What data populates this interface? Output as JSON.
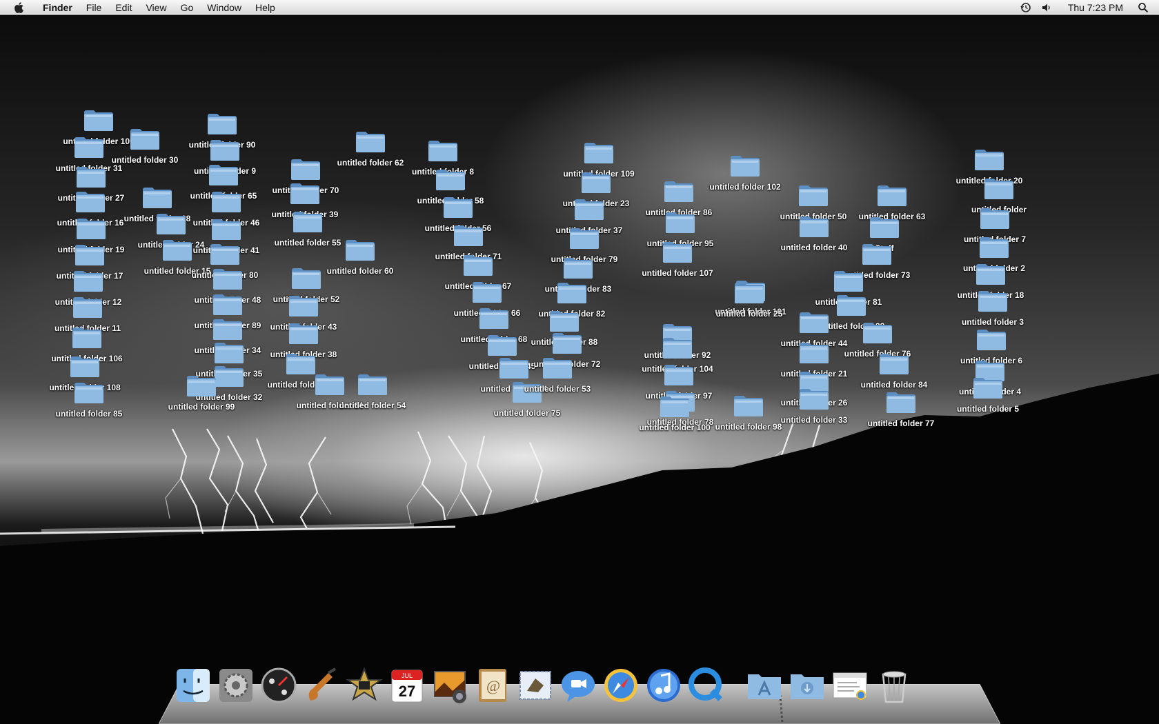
{
  "menubar": {
    "app_name": "Finder",
    "menus": [
      "File",
      "Edit",
      "View",
      "Go",
      "Window",
      "Help"
    ],
    "clock": "Thu 7:23 PM",
    "status_icons": [
      "time-machine-icon",
      "volume-icon",
      "spotlight-icon"
    ]
  },
  "desktop_icons": [
    {
      "label": "untitled folder 105",
      "visible_label": "untitled folder 105"
    },
    {
      "label": "untitled folder 31",
      "visible_label": "untitled folder 31"
    },
    {
      "label": "untitled folder 27",
      "visible_label": "untitled folder 27"
    },
    {
      "label": "untitled folder 16",
      "visible_label": "untitled folder 16"
    },
    {
      "label": "untitled folder 19",
      "visible_label": "untitled folder 19"
    },
    {
      "label": "untitled folder 17",
      "visible_label": "untitled folder 17"
    },
    {
      "label": "untitled folder 12",
      "visible_label": "untitled folder 12"
    },
    {
      "label": "untitled folder 11",
      "visible_label": "untitled folder 11"
    },
    {
      "label": "untitled folder 106",
      "visible_label": "untitled folder 106"
    },
    {
      "label": "untitled folder 108",
      "visible_label": "untitled folder 108"
    },
    {
      "label": "untitled folder 85",
      "visible_label": "untitled folder 85"
    },
    {
      "label": "untitled folder 30",
      "visible_label": "untitled folder 30"
    },
    {
      "label": "untitled folder 28",
      "visible_label": "untitled folder 28"
    },
    {
      "label": "untitled folder 24",
      "visible_label": "untitled folder 24"
    },
    {
      "label": "untitled folder 15",
      "visible_label": "untitled folder 15"
    },
    {
      "label": "untitled folder 90",
      "visible_label": "untitled folder 90"
    },
    {
      "label": "untitled folder 9",
      "visible_label": "untitled folder 9"
    },
    {
      "label": "untitled folder 65",
      "visible_label": "untitled folder 65"
    },
    {
      "label": "untitled folder 46",
      "visible_label": "untitled folder 46"
    },
    {
      "label": "untitled folder 41",
      "visible_label": "untitled folder 41"
    },
    {
      "label": "untitled folder 80",
      "visible_label": "untitled folder 80"
    },
    {
      "label": "untitled folder 48",
      "visible_label": "untitled folder 48"
    },
    {
      "label": "untitled folder 89",
      "visible_label": "untitled folder 89"
    },
    {
      "label": "untitled folder 34",
      "visible_label": "untitled folder 34"
    },
    {
      "label": "untitled folder 35",
      "visible_label": "untitled folder 35"
    },
    {
      "label": "untitled folder 32",
      "visible_label": "untitled folder 32"
    },
    {
      "label": "untitled folder 99",
      "visible_label": "untitled folder 99"
    },
    {
      "label": "untitled folder 62",
      "visible_label": "untitled folder 62"
    },
    {
      "label": "untitled folder 70",
      "visible_label": "untitled folder 70"
    },
    {
      "label": "untitled folder 39",
      "visible_label": "untitled folder 39"
    },
    {
      "label": "untitled folder 55",
      "visible_label": "untitled folder 55"
    },
    {
      "label": "untitled folder 60",
      "visible_label": "untitled folder 60"
    },
    {
      "label": "untitled folder 52",
      "visible_label": "untitled folder 52"
    },
    {
      "label": "untitled folder 43",
      "visible_label": "untitled folder 43"
    },
    {
      "label": "untitled folder 38",
      "visible_label": "untitled folder 38"
    },
    {
      "label": "untitled folder 93",
      "visible_label": "untitled folder 93"
    },
    {
      "label": "untitled folder 64",
      "visible_label": "untitled folder 64"
    },
    {
      "label": "untitled folder 54",
      "visible_label": "untitled folder 54"
    },
    {
      "label": "untitled folder 8",
      "visible_label": "untitled folder 8"
    },
    {
      "label": "untitled folder 58",
      "visible_label": "untitled folder 58"
    },
    {
      "label": "untitled folder 56",
      "visible_label": "untitled folder 56"
    },
    {
      "label": "untitled folder 71",
      "visible_label": "untitled folder 71"
    },
    {
      "label": "untitled folder 67",
      "visible_label": "untitled folder 67"
    },
    {
      "label": "untitled folder 66",
      "visible_label": "untitled folder 66"
    },
    {
      "label": "untitled folder 68",
      "visible_label": "untitled folder 68"
    },
    {
      "label": "untitled folder 45",
      "visible_label": "untitled folder 45"
    },
    {
      "label": "untitled folder 74",
      "visible_label": "untitled folder 74"
    },
    {
      "label": "untitled folder 75",
      "visible_label": "untitled folder 75"
    },
    {
      "label": "untitled folder 109",
      "visible_label": "untitled folder 109"
    },
    {
      "label": "untitled folder 23",
      "visible_label": "untitled folder 23"
    },
    {
      "label": "untitled folder 37",
      "visible_label": "untitled folder 37"
    },
    {
      "label": "untitled folder 79",
      "visible_label": "untitled folder 79"
    },
    {
      "label": "untitled folder 83",
      "visible_label": "untitled folder 83"
    },
    {
      "label": "untitled folder 82",
      "visible_label": "untitled folder 82"
    },
    {
      "label": "untitled folder 88",
      "visible_label": "untitled folder 88"
    },
    {
      "label": "untitled folder 72",
      "visible_label": "untitled folder 72"
    },
    {
      "label": "untitled folder 53",
      "visible_label": "untitled folder 53"
    },
    {
      "label": "untitled folder 102",
      "visible_label": "untitled folder 102"
    },
    {
      "label": "untitled folder 86",
      "visible_label": "untitled folder 86"
    },
    {
      "label": "untitled folder 95",
      "visible_label": "untitled folder 95"
    },
    {
      "label": "untitled folder 107",
      "visible_label": "untitled folder 107"
    },
    {
      "label": "untitled folder 101",
      "visible_label": "untitled folder 101"
    },
    {
      "label": "untitled folder 25",
      "visible_label": "untitled folder 25"
    },
    {
      "label": "untitled folder 92",
      "visible_label": "untitled folder 92"
    },
    {
      "label": "untitled folder 104",
      "visible_label": "untitled folder 104"
    },
    {
      "label": "untitled folder 97",
      "visible_label": "untitled folder 97"
    },
    {
      "label": "untitled folder 78",
      "visible_label": "untitled folder 78"
    },
    {
      "label": "untitled folder 100",
      "visible_label": "untitled folder 100"
    },
    {
      "label": "untitled folder 98",
      "visible_label": "untitled folder 98"
    },
    {
      "label": "untitled folder 50",
      "visible_label": "untitled folder 50"
    },
    {
      "label": "untitled folder 40",
      "visible_label": "untitled folder 40"
    },
    {
      "label": "untitled folder 63",
      "visible_label": "untitled folder 63"
    },
    {
      "label": "Stuff",
      "visible_label": "Stuff"
    },
    {
      "label": "untitled folder 73",
      "visible_label": "untitled folder 73"
    },
    {
      "label": "untitled folder 81",
      "visible_label": "untitled folder 81"
    },
    {
      "label": "untitled folder 22",
      "visible_label": "untitled folder 22"
    },
    {
      "label": "untitled folder 44",
      "visible_label": "untitled folder 44"
    },
    {
      "label": "untitled folder 76",
      "visible_label": "untitled folder 76"
    },
    {
      "label": "untitled folder 21",
      "visible_label": "untitled folder 21"
    },
    {
      "label": "untitled folder 84",
      "visible_label": "untitled folder 84"
    },
    {
      "label": "untitled folder 26",
      "visible_label": "untitled folder 26"
    },
    {
      "label": "untitled folder 77",
      "visible_label": "untitled folder 77"
    },
    {
      "label": "untitled folder 33",
      "visible_label": "untitled folder 33"
    },
    {
      "label": "untitled folder 20",
      "visible_label": "untitled folder 20"
    },
    {
      "label": "untitled folder",
      "visible_label": "untitled folder"
    },
    {
      "label": "untitled folder 7",
      "visible_label": "untitled folder 7"
    },
    {
      "label": "untitled folder 2",
      "visible_label": "untitled folder 2"
    },
    {
      "label": "untitled folder 18",
      "visible_label": "untitled folder 18"
    },
    {
      "label": "untitled folder 3",
      "visible_label": "untitled folder 3"
    },
    {
      "label": "untitled folder 6",
      "visible_label": "untitled folder 6"
    },
    {
      "label": "untitled folder 4",
      "visible_label": "untitled folder 4"
    },
    {
      "label": "untitled folder 5",
      "visible_label": "untitled folder 5"
    }
  ],
  "dock": {
    "items": [
      {
        "name": "Finder",
        "icon": "finder-icon"
      },
      {
        "name": "System Preferences",
        "icon": "system-preferences-icon"
      },
      {
        "name": "Dashboard",
        "icon": "dashboard-icon"
      },
      {
        "name": "GarageBand",
        "icon": "garageband-icon"
      },
      {
        "name": "iMovie",
        "icon": "imovie-icon"
      },
      {
        "name": "iCal",
        "icon": "ical-icon",
        "calendar_month": "JUL",
        "calendar_day": "27"
      },
      {
        "name": "iPhoto",
        "icon": "iphoto-icon"
      },
      {
        "name": "Address Book",
        "icon": "address-book-icon"
      },
      {
        "name": "Mail",
        "icon": "mail-icon"
      },
      {
        "name": "iChat",
        "icon": "ichat-icon"
      },
      {
        "name": "Safari",
        "icon": "safari-icon"
      },
      {
        "name": "iTunes",
        "icon": "itunes-icon"
      },
      {
        "name": "QuickTime Player",
        "icon": "quicktime-icon"
      },
      {
        "name": "Applications",
        "icon": "applications-folder-icon"
      },
      {
        "name": "Downloads",
        "icon": "downloads-folder-icon"
      },
      {
        "name": "Document",
        "icon": "document-icon"
      },
      {
        "name": "Trash",
        "icon": "trash-icon"
      }
    ]
  },
  "colors": {
    "folder_blue": "#8fbbe3",
    "folder_blue_dark": "#5d8fc2",
    "menubar_bg": "#e6e6e6"
  }
}
